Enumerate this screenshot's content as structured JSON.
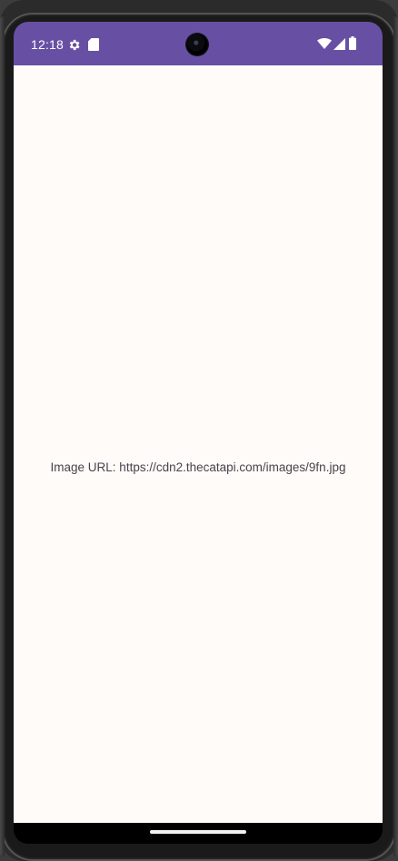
{
  "status_bar": {
    "time": "12:18",
    "color": "#6750a4",
    "icons": [
      "settings-gear-icon",
      "sd-card-icon",
      "wifi-icon",
      "cellular-signal-icon",
      "battery-icon"
    ]
  },
  "main": {
    "image_url_text": "Image URL: https://cdn2.thecatapi.com/images/9fn.jpg",
    "background": "#fffbf9"
  },
  "navigation": {
    "gesture_handle": "home-gesture-handle"
  }
}
